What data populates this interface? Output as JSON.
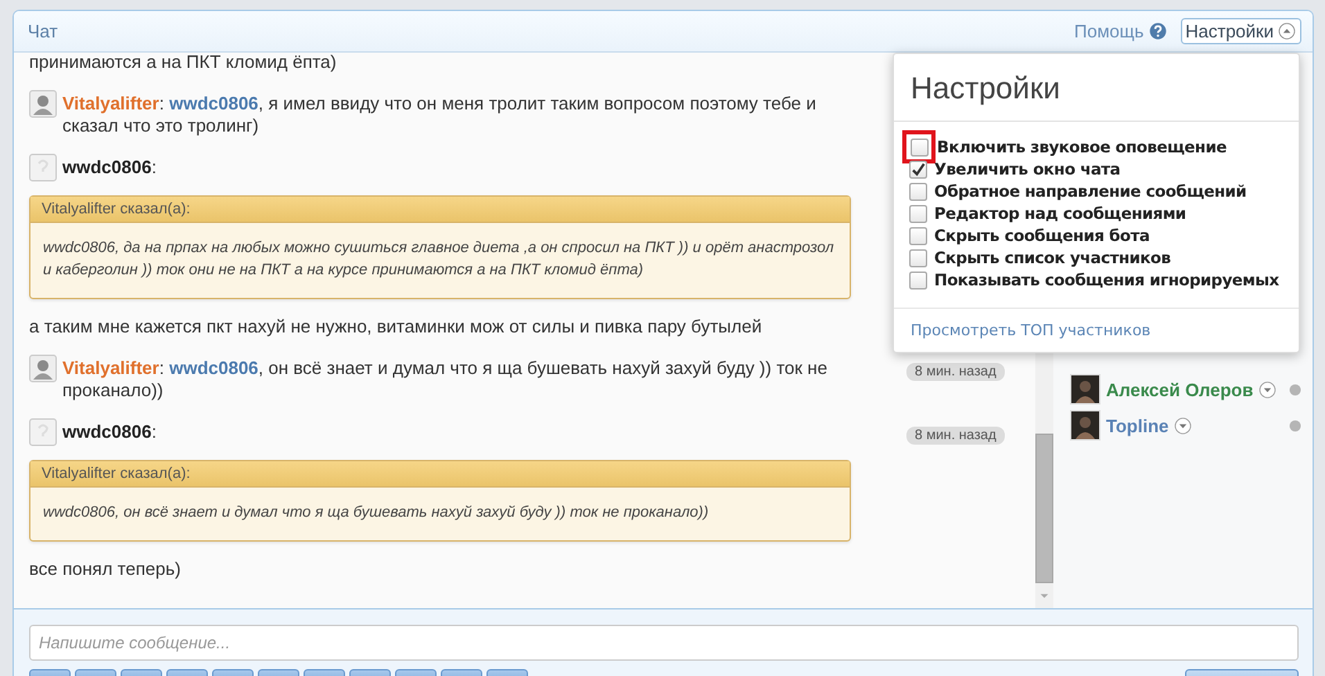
{
  "chat": {
    "title": "Чат",
    "help": "Помощь",
    "settings_button": {
      "label": "Настройки",
      "expanded": true
    }
  },
  "messages": [
    {
      "text": "принимаются а на ПКТ кломид ёпта)"
    },
    {
      "author": "Vitalyalifter",
      "color": "#e0702c",
      "text": ": **wwdc0806**, я имел ввиду что он меня тролит таким вопросом поэтому тебе и сказал что это тролинг)"
    },
    {
      "author": "wwdc0806",
      "color": "#222222",
      "kind": "default",
      "text": ":",
      "quote": {
        "header": "Vitalyalifter сказал(а):",
        "text": "wwdc0806, да на прпах на любых можно сушиться главное диета ,а он спросил на ПКТ )) и орёт анастрозол и каберголин )) ток они не на ПКТ а на курсе принимаются а на ПКТ кломид ёпта)"
      },
      "after": "а таким мне кажется пкт нахуй не нужно, витаминки мож от силы и пивка пару бутылей"
    },
    {
      "author": "Vitalyalifter",
      "color": "#e0702c",
      "time": "8 мин. назад",
      "text": ": **wwdc0806**, он всё знает и думал что я ща бушевать нахуй захуй буду )) ток не проканало))"
    },
    {
      "author": "wwdc0806",
      "color": "#222222",
      "kind": "default",
      "time": "8 мин. назад",
      "text": ":",
      "quote": {
        "header": "Vitalyalifter сказал(а):",
        "text": "wwdc0806, он всё знает и думал что я ща бушевать нахуй захуй буду )) ток не проканало))"
      },
      "after": "все понял теперь)"
    }
  ],
  "users": [
    {
      "name": "Алексей Олеров",
      "color": "#3a8a4c"
    },
    {
      "name": "Topline",
      "color": "#5a82b5"
    }
  ],
  "composer": {
    "placeholder": "Напишите сообщение..."
  },
  "settings_popup": {
    "title": "Настройки",
    "options": [
      {
        "label": "Включить звуковое оповещение",
        "checked": false,
        "highlighted": true
      },
      {
        "label": "Увеличить окно чата",
        "checked": true,
        "highlighted": false
      },
      {
        "label": "Обратное направление сообщений",
        "checked": false,
        "highlighted": false
      },
      {
        "label": "Редактор над сообщениями",
        "checked": false,
        "highlighted": false
      },
      {
        "label": "Скрыть сообщения бота",
        "checked": false,
        "highlighted": false
      },
      {
        "label": "Скрыть список участников",
        "checked": false,
        "highlighted": false
      },
      {
        "label": "Показывать сообщения игнорируемых",
        "checked": false,
        "highlighted": false
      }
    ],
    "link": "Просмотреть ТОП участников"
  }
}
